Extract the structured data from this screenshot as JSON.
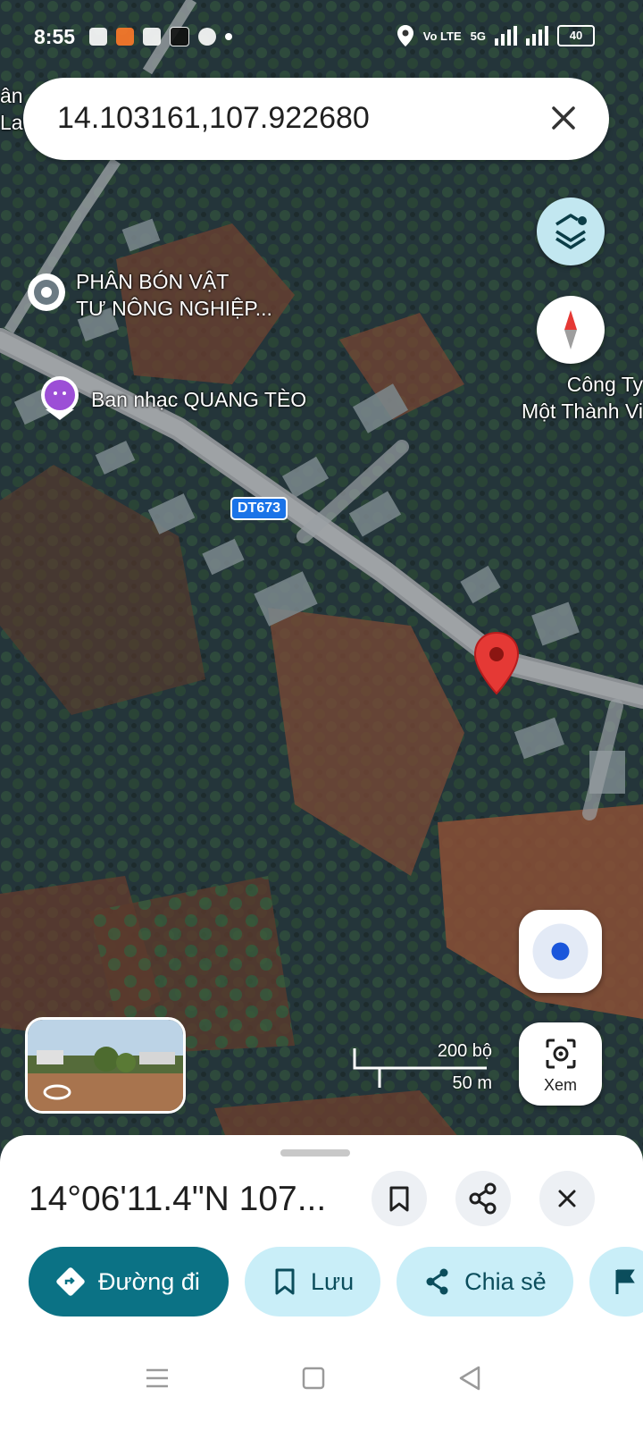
{
  "status_bar": {
    "time": "8:55",
    "network": "Vo LTE",
    "signal": "5G",
    "battery": "40"
  },
  "search": {
    "value": "14.103161,107.922680"
  },
  "map": {
    "labels": {
      "poi_fertilizer": [
        "PHÂN BÓN VẬT",
        "TƯ NÔNG NGHIỆP..."
      ],
      "poi_band": "Ban nhạc QUANG TÈO",
      "company": [
        "Công Ty",
        "Một Thành Vi"
      ],
      "edge_label": [
        "ân",
        "La"
      ]
    },
    "route_shield": "DT673",
    "scale": {
      "imperial": "200 bộ",
      "metric": "50 m"
    }
  },
  "lens_button": {
    "label": "Xem"
  },
  "sheet": {
    "title": "14°06'11.4\"N 107...",
    "actions": {
      "directions": "Đường đi",
      "save": "Lưu",
      "share": "Chia sẻ"
    }
  },
  "colors": {
    "primary": "#0b7285",
    "chip_bg": "#c9eef8",
    "pin": "#e53935",
    "layers_bg": "#c2e7f0"
  }
}
